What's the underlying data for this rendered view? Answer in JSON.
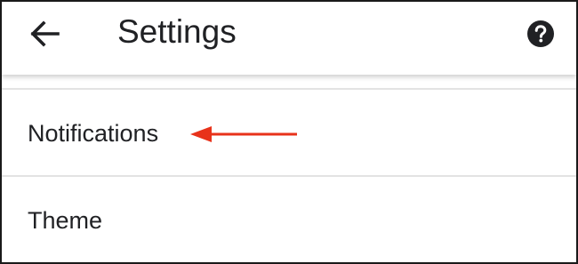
{
  "header": {
    "title": "Settings",
    "back_icon": "arrow-back-icon",
    "help_icon": "help-circle-icon"
  },
  "settings": {
    "items": [
      {
        "label": "Notifications"
      },
      {
        "label": "Theme"
      }
    ]
  },
  "annotation": {
    "arrow_color": "#e8321a",
    "points_to": "Notifications"
  },
  "colors": {
    "text": "#202124",
    "divider": "#e3e3e3",
    "background": "#ffffff"
  }
}
